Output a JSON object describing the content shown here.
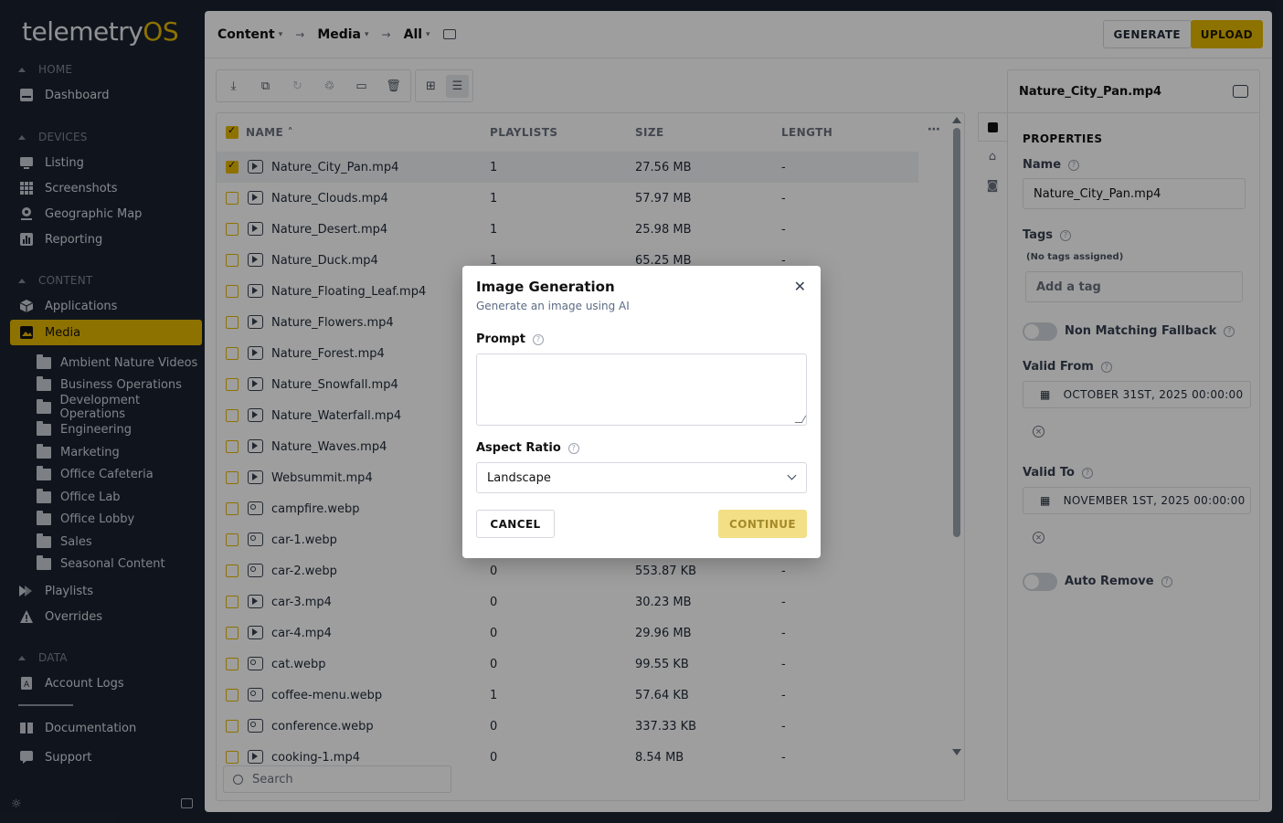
{
  "app": {
    "logo_main": "telemetry",
    "logo_accent": "OS"
  },
  "sidebar": {
    "sections": {
      "home": "HOME",
      "devices": "DEVICES",
      "content": "CONTENT",
      "data": "DATA"
    },
    "items": {
      "dashboard": "Dashboard",
      "listing": "Listing",
      "screenshots": "Screenshots",
      "geomap": "Geographic Map",
      "reporting": "Reporting",
      "applications": "Applications",
      "media": "Media",
      "playlists": "Playlists",
      "overrides": "Overrides",
      "account_logs": "Account Logs",
      "documentation": "Documentation",
      "support": "Support"
    },
    "folders": [
      "Ambient Nature Videos",
      "Business Operations",
      "Development Operations",
      "Engineering",
      "Marketing",
      "Office Cafeteria",
      "Office Lab",
      "Office Lobby",
      "Sales",
      "Seasonal Content"
    ]
  },
  "header": {
    "crumb1": "Content",
    "crumb2": "Media",
    "crumb3": "All",
    "generate": "GENERATE",
    "upload": "UPLOAD"
  },
  "table": {
    "columns": {
      "name": "NAME",
      "playlists": "PLAYLISTS",
      "size": "SIZE",
      "length": "LENGTH"
    },
    "rows": [
      {
        "name": "Nature_City_Pan.mp4",
        "playlists": "1",
        "size": "27.56 MB",
        "length": "-",
        "type": "video",
        "selected": true
      },
      {
        "name": "Nature_Clouds.mp4",
        "playlists": "1",
        "size": "57.97 MB",
        "length": "-",
        "type": "video"
      },
      {
        "name": "Nature_Desert.mp4",
        "playlists": "1",
        "size": "25.98 MB",
        "length": "-",
        "type": "video"
      },
      {
        "name": "Nature_Duck.mp4",
        "playlists": "1",
        "size": "65.25 MB",
        "length": "-",
        "type": "video"
      },
      {
        "name": "Nature_Floating_Leaf.mp4",
        "playlists": "",
        "size": "",
        "length": "",
        "type": "video"
      },
      {
        "name": "Nature_Flowers.mp4",
        "playlists": "",
        "size": "",
        "length": "",
        "type": "video"
      },
      {
        "name": "Nature_Forest.mp4",
        "playlists": "",
        "size": "",
        "length": "",
        "type": "video"
      },
      {
        "name": "Nature_Snowfall.mp4",
        "playlists": "",
        "size": "",
        "length": "",
        "type": "video"
      },
      {
        "name": "Nature_Waterfall.mp4",
        "playlists": "",
        "size": "",
        "length": "",
        "type": "video"
      },
      {
        "name": "Nature_Waves.mp4",
        "playlists": "",
        "size": "",
        "length": "",
        "type": "video"
      },
      {
        "name": "Websummit.mp4",
        "playlists": "",
        "size": "",
        "length": "",
        "type": "video"
      },
      {
        "name": "campfire.webp",
        "playlists": "",
        "size": "",
        "length": "",
        "type": "image"
      },
      {
        "name": "car-1.webp",
        "playlists": "",
        "size": "",
        "length": "",
        "type": "image"
      },
      {
        "name": "car-2.webp",
        "playlists": "0",
        "size": "553.87 KB",
        "length": "-",
        "type": "image"
      },
      {
        "name": "car-3.mp4",
        "playlists": "0",
        "size": "30.23 MB",
        "length": "-",
        "type": "video"
      },
      {
        "name": "car-4.mp4",
        "playlists": "0",
        "size": "29.96 MB",
        "length": "-",
        "type": "video"
      },
      {
        "name": "cat.webp",
        "playlists": "0",
        "size": "99.55 KB",
        "length": "-",
        "type": "image"
      },
      {
        "name": "coffee-menu.webp",
        "playlists": "1",
        "size": "57.64 KB",
        "length": "-",
        "type": "image"
      },
      {
        "name": "conference.webp",
        "playlists": "0",
        "size": "337.33 KB",
        "length": "-",
        "type": "image"
      },
      {
        "name": "cooking-1.mp4",
        "playlists": "0",
        "size": "8.54 MB",
        "length": "-",
        "type": "video"
      }
    ],
    "search_placeholder": "Search"
  },
  "properties": {
    "file_title": "Nature_City_Pan.mp4",
    "heading": "PROPERTIES",
    "name_label": "Name",
    "name_value": "Nature_City_Pan.mp4",
    "tags_label": "Tags",
    "no_tags": "(No tags assigned)",
    "add_tag_placeholder": "Add a tag",
    "fallback_label": "Non Matching Fallback",
    "valid_from_label": "Valid From",
    "valid_from_value": "OCTOBER 31ST, 2025 00:00:00",
    "valid_to_label": "Valid To",
    "valid_to_value": "NOVEMBER 1ST, 2025 00:00:00",
    "auto_remove_label": "Auto Remove"
  },
  "modal": {
    "title": "Image Generation",
    "subtitle": "Generate an image using AI",
    "prompt_label": "Prompt",
    "prompt_value": "",
    "aspect_label": "Aspect Ratio",
    "aspect_value": "Landscape",
    "cancel": "CANCEL",
    "continue": "CONTINUE"
  },
  "colors": {
    "accent": "#e6b800",
    "sidebar_bg": "#1b2230"
  }
}
